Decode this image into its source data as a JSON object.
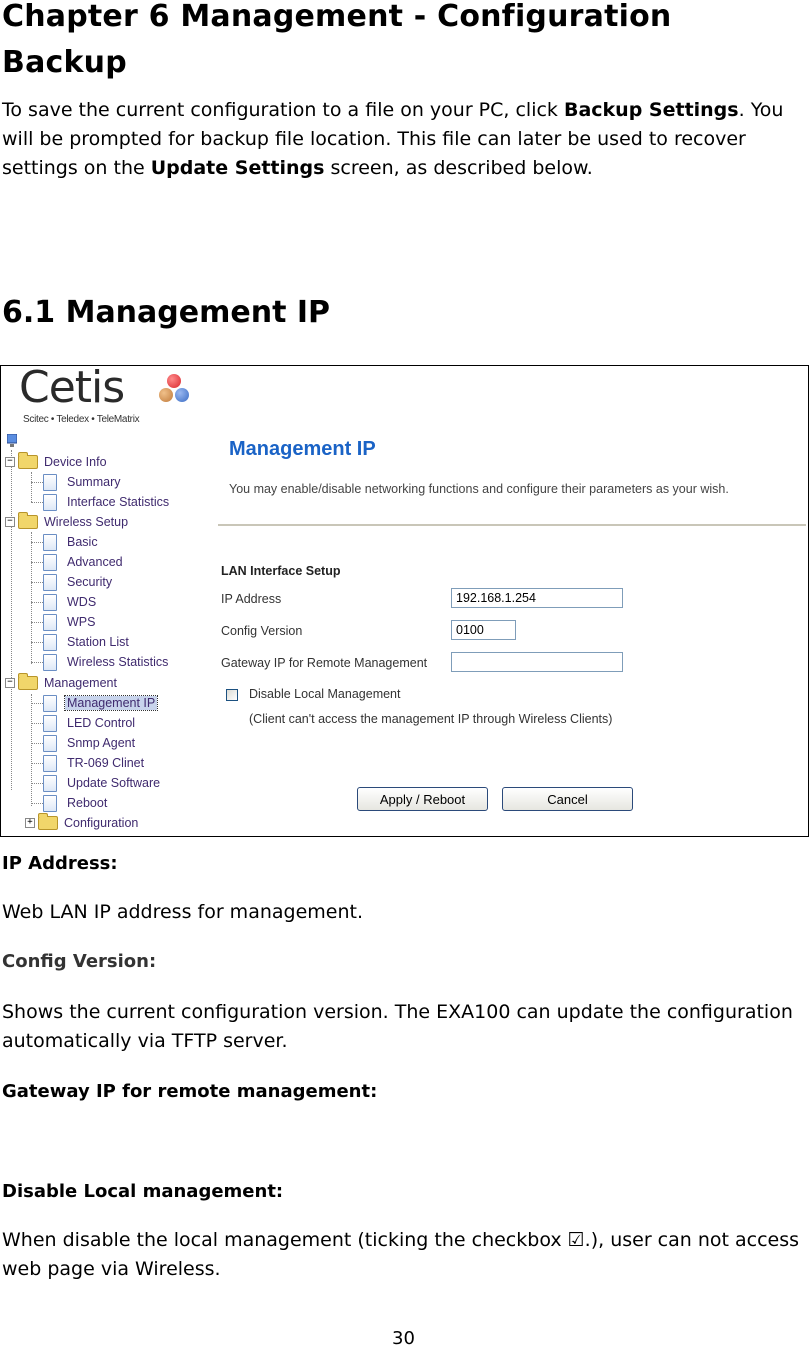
{
  "document": {
    "chapter_title": "Chapter 6 Management - Configuration Backup",
    "intro": {
      "part1": "To save the current configuration to a file on your PC, click ",
      "bold1": "Backup Settings",
      "part2": ".  You will be prompted for backup file location. This file can later be used to recover settings on the ",
      "bold2": "Update Settings",
      "part3": " screen, as described below."
    },
    "section_title": "6.1 Management IP",
    "fields": [
      {
        "label": "IP Address:",
        "description": "Web LAN IP address for management."
      },
      {
        "label": "Config Version:",
        "description": "Shows the current configuration version. The EXA100 can update the configuration automatically via TFTP server."
      },
      {
        "label": "Gateway IP for remote management:",
        "description": ""
      },
      {
        "label": "Disable Local management:",
        "description": "When disable the local management (ticking the checkbox ☑.), user can not access web page via Wireless."
      }
    ],
    "page_number": "30"
  },
  "screenshot": {
    "logo": {
      "brand": "Cetis",
      "tagline": "Scitec • Teledex • TeleMatrix",
      "dot_colors": [
        "#d8262e",
        "#c07a3a",
        "#3a6cc4"
      ]
    },
    "tree": {
      "root_icon": "computer-icon",
      "groups": [
        {
          "label": "Device Info",
          "expanded": true,
          "items": [
            "Summary",
            "Interface Statistics"
          ]
        },
        {
          "label": "Wireless Setup",
          "expanded": true,
          "items": [
            "Basic",
            "Advanced",
            "Security",
            "WDS",
            "WPS",
            "Station List",
            "Wireless Statistics"
          ]
        },
        {
          "label": "Management",
          "expanded": true,
          "items": [
            "Management IP",
            "LED Control",
            "Snmp Agent",
            "TR-069 Clinet",
            "Update Software",
            "Reboot"
          ]
        },
        {
          "label": "Configuration",
          "expanded": false,
          "items": []
        }
      ],
      "selected": "Management IP"
    },
    "content": {
      "title": "Management IP",
      "description": "You may enable/disable networking functions and configure their parameters as your wish.",
      "section": "LAN Interface Setup",
      "ip_address_label": "IP Address",
      "ip_address_value": "192.168.1.254",
      "config_version_label": "Config Version",
      "config_version_value": "0100",
      "gateway_label": "Gateway IP for Remote Management",
      "gateway_value": "",
      "disable_local_label": "Disable Local Management",
      "disable_local_checked": false,
      "note": "(Client can't access the management IP through Wireless Clients)",
      "apply_button": "Apply / Reboot",
      "cancel_button": "Cancel",
      "title_color": "#1a63c6"
    }
  }
}
